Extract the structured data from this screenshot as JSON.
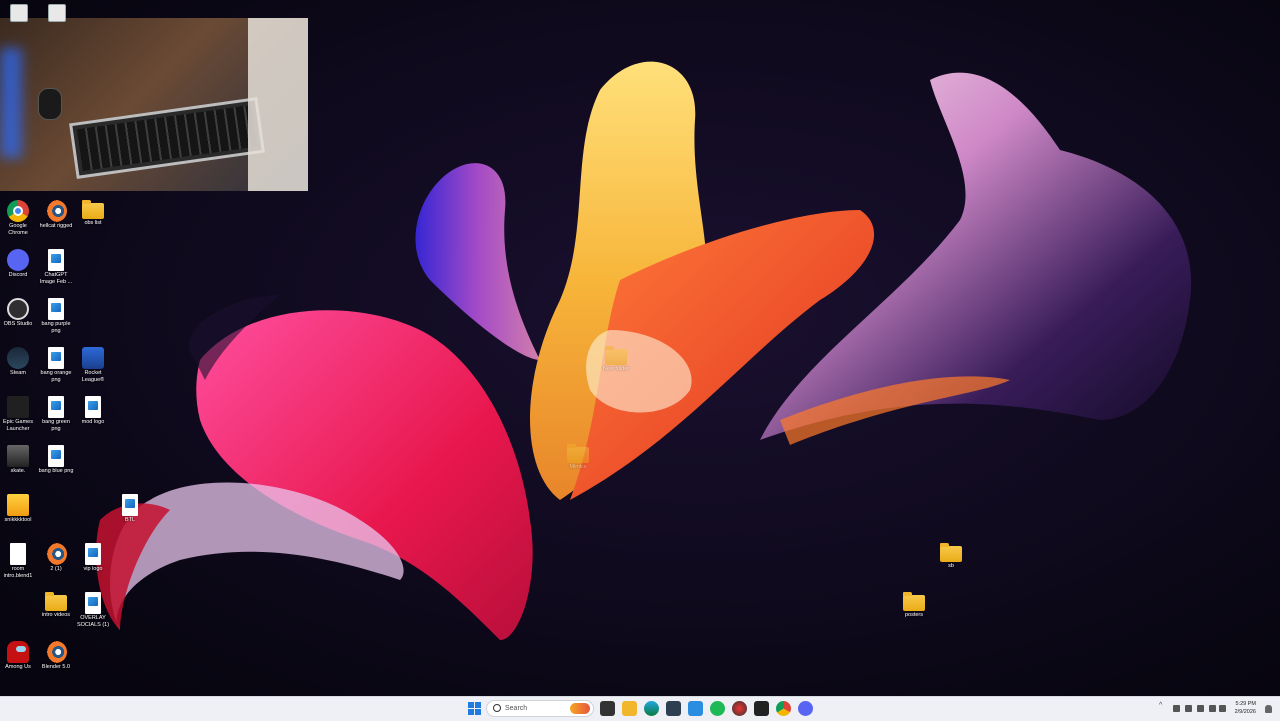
{
  "desktop": {
    "icons": [
      {
        "label": "Google Chrome",
        "icon": "chrome-icon"
      },
      {
        "label": "hellcat rigged",
        "icon": "blender-icon"
      },
      {
        "label": "obs list",
        "icon": "folder-icon"
      },
      {
        "label": "Discord",
        "icon": "discord-icon"
      },
      {
        "label": "ChatGPT Image Feb ...",
        "icon": "image-file-icon"
      },
      {
        "label": "OBS Studio",
        "icon": "obs-icon"
      },
      {
        "label": "bang purple png",
        "icon": "image-file-icon"
      },
      {
        "label": "Steam",
        "icon": "steam-icon"
      },
      {
        "label": "bang orange png",
        "icon": "image-file-icon"
      },
      {
        "label": "Rocket League®",
        "icon": "rocket-league-icon"
      },
      {
        "label": "Epic Games Launcher",
        "icon": "epic-games-icon"
      },
      {
        "label": "bang green png",
        "icon": "image-file-icon"
      },
      {
        "label": "mod logo",
        "icon": "image-file-icon"
      },
      {
        "label": "skate.",
        "icon": "skate-icon"
      },
      {
        "label": "bang blue png",
        "icon": "image-file-icon"
      },
      {
        "label": "snikkkktool",
        "icon": "snipping-tool-icon"
      },
      {
        "label": "BTL",
        "icon": "image-file-icon"
      },
      {
        "label": "room intro.blend1",
        "icon": "document-icon"
      },
      {
        "label": "2 (1)",
        "icon": "blender-icon"
      },
      {
        "label": "vip logo",
        "icon": "image-file-icon"
      },
      {
        "label": "intro videos",
        "icon": "folder-icon"
      },
      {
        "label": "OVERLAY SOCIALS (1)",
        "icon": "image-file-icon"
      },
      {
        "label": "Among Us",
        "icon": "among-us-icon"
      },
      {
        "label": "Blender 5.0",
        "icon": "blender-icon"
      },
      {
        "label": "New folder",
        "icon": "folder-icon"
      },
      {
        "label": "Mimics",
        "icon": "folder-icon"
      },
      {
        "label": "sb",
        "icon": "folder-icon"
      },
      {
        "label": "posters",
        "icon": "folder-icon"
      }
    ]
  },
  "taskbar": {
    "search_placeholder": "Search",
    "apps": [
      "file-explorer-icon",
      "task-view-icon",
      "folder-icon",
      "edge-icon",
      "store-icon",
      "photos-icon",
      "spotify-icon",
      "davinci-icon",
      "terminal-icon",
      "chrome-icon",
      "discord-icon"
    ],
    "clock_time": "5:29 PM",
    "clock_date": "2/9/2026"
  },
  "colors": {
    "accent": "#1f7be0",
    "desktop_bg": "#0c0818"
  }
}
